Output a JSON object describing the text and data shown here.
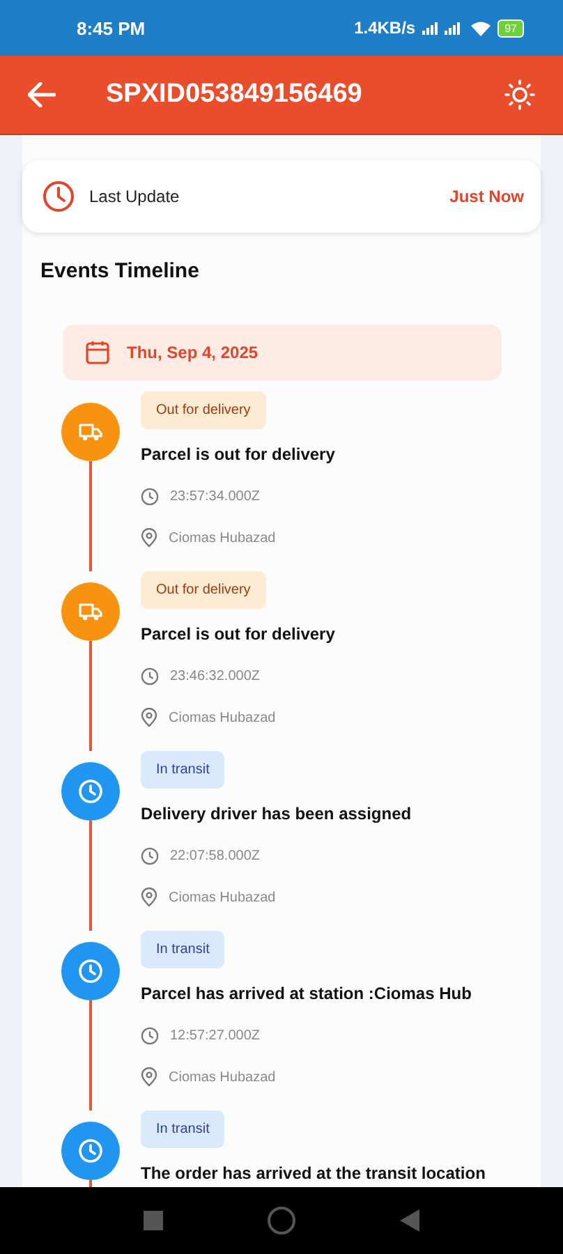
{
  "status_bar": {
    "time": "8:45 PM",
    "speed": "1.4KB/s",
    "battery": "97"
  },
  "app_bar": {
    "title": "SPXID053849156469"
  },
  "last_update": {
    "label": "Last Update",
    "value": "Just Now"
  },
  "timeline": {
    "title": "Events Timeline",
    "date": "Thu, Sep 4, 2025",
    "events": [
      {
        "kind": "delivery",
        "status": "Out for delivery",
        "description": "Parcel is out for delivery",
        "time": "23:57:34.000Z",
        "location": "Ciomas Hubazad"
      },
      {
        "kind": "delivery",
        "status": "Out for delivery",
        "description": "Parcel is out for delivery",
        "time": "23:46:32.000Z",
        "location": "Ciomas Hubazad"
      },
      {
        "kind": "transit",
        "status": "In transit",
        "description": "Delivery driver has been assigned",
        "time": "22:07:58.000Z",
        "location": "Ciomas Hubazad"
      },
      {
        "kind": "transit",
        "status": "In transit",
        "description": "Parcel has arrived at station :Ciomas Hub",
        "time": "12:57:27.000Z",
        "location": "Ciomas Hubazad"
      },
      {
        "kind": "transit",
        "status": "In transit",
        "description": "The order has arrived at the transit location"
      }
    ]
  }
}
